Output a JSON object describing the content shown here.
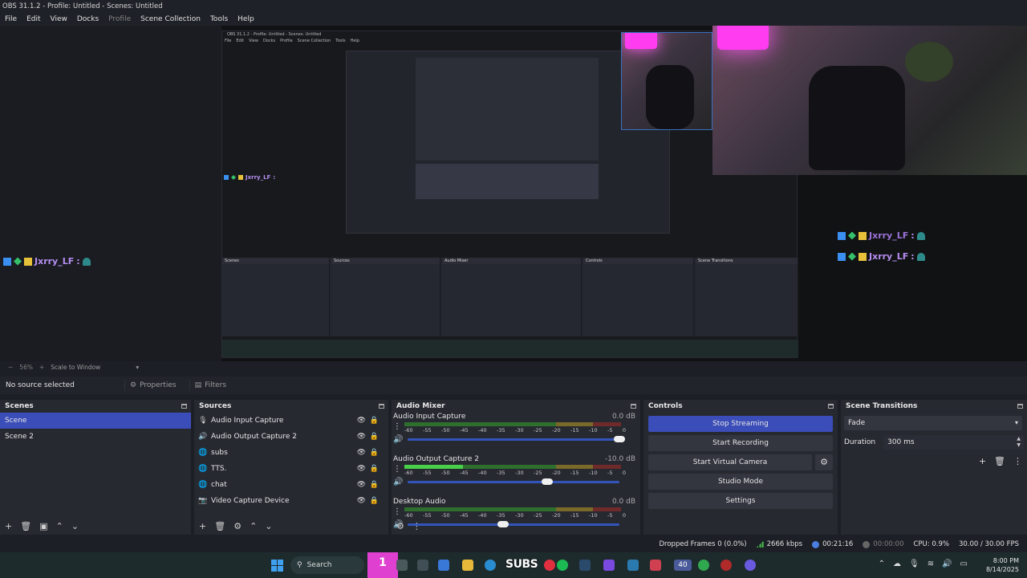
{
  "window": {
    "title": "OBS 31.1.2 - Profile: Untitled - Scenes: Untitled"
  },
  "menu": [
    "File",
    "Edit",
    "View",
    "Docks",
    "Profile",
    "Scene Collection",
    "Tools",
    "Help"
  ],
  "preview": {
    "chat_user": "Jxrry_LF",
    "nested_title": "OBS 31.1.2 - Profile: Untitled - Scenes: Untitled",
    "nested_menu": [
      "File",
      "Edit",
      "View",
      "Docks",
      "Profile",
      "Scene Collection",
      "Tools",
      "Help"
    ]
  },
  "zoom": {
    "level": "56%",
    "mode": "Scale to Window"
  },
  "selection": {
    "status": "No source selected",
    "properties_label": "Properties",
    "filters_label": "Filters"
  },
  "scenes": {
    "title": "Scenes",
    "items": [
      "Scene",
      "Scene 2"
    ],
    "active": 0
  },
  "sources": {
    "title": "Sources",
    "items": [
      {
        "name": "Audio Input Capture",
        "icon": "microphone-icon"
      },
      {
        "name": "Audio Output Capture 2",
        "icon": "speaker-icon"
      },
      {
        "name": "subs",
        "icon": "globe-icon"
      },
      {
        "name": "TTS.",
        "icon": "globe-icon"
      },
      {
        "name": "chat",
        "icon": "globe-icon"
      },
      {
        "name": "Video Capture Device",
        "icon": "camera-icon"
      }
    ]
  },
  "mixer": {
    "title": "Audio Mixer",
    "scale": [
      "-60",
      "-55",
      "-50",
      "-45",
      "-40",
      "-35",
      "-30",
      "-25",
      "-20",
      "-15",
      "-10",
      "-5",
      "0"
    ],
    "channels": [
      {
        "name": "Audio Input Capture",
        "db": "0.0 dB",
        "level": 0.0,
        "volume": 1.0
      },
      {
        "name": "Audio Output Capture 2",
        "db": "-10.0 dB",
        "level": 0.27,
        "volume": 0.66
      },
      {
        "name": "Desktop Audio",
        "db": "0.0 dB",
        "level": 0.0,
        "volume": 0.45
      }
    ]
  },
  "controls": {
    "title": "Controls",
    "stop_streaming": "Stop Streaming",
    "start_recording": "Start Recording",
    "start_virtual_camera": "Start Virtual Camera",
    "studio_mode": "Studio Mode",
    "settings": "Settings"
  },
  "transitions": {
    "title": "Scene Transitions",
    "selected": "Fade",
    "duration_label": "Duration",
    "duration_value": "300 ms"
  },
  "status": {
    "dropped": "Dropped Frames 0 (0.0%)",
    "bitrate": "2666 kbps",
    "stream_time": "00:21:16",
    "record_time": "00:00:00",
    "cpu": "CPU: 0.9%",
    "fps": "30.00 / 30.00 FPS"
  },
  "taskbar": {
    "search": "Search",
    "workspace": "1",
    "subs_overlay": "SUBS",
    "badge": "40",
    "time": "8:00 PM",
    "date": "8/14/2025"
  },
  "colors": {
    "accent": "#3b4db8",
    "background": "#1d1f26",
    "panel": "#272931"
  }
}
